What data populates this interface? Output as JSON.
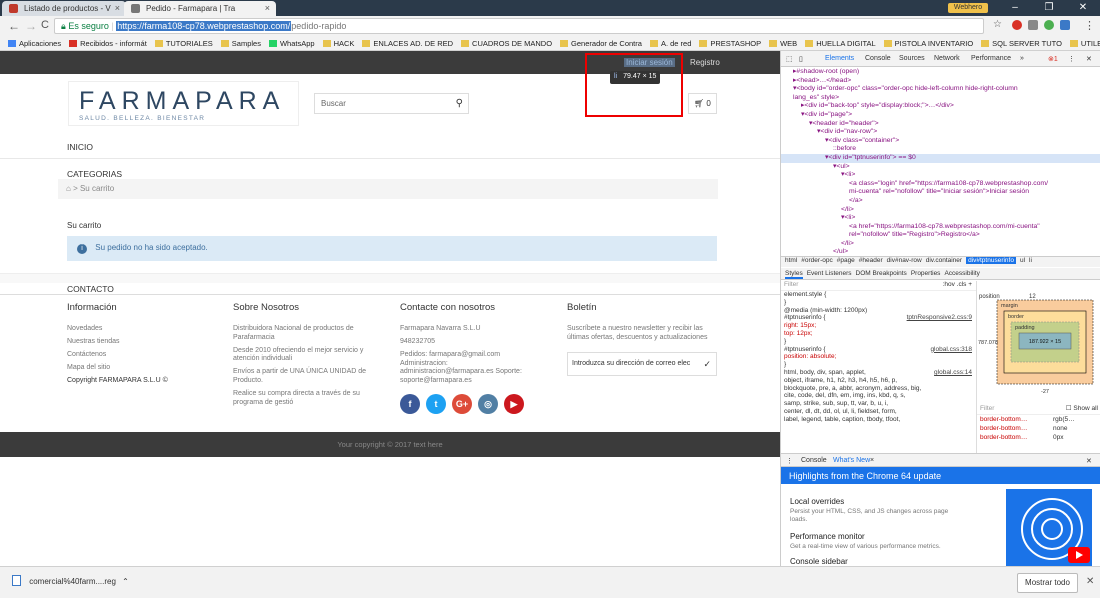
{
  "browser": {
    "tabs": [
      {
        "title": "Listado de productos - V",
        "favicon_color": "#c0392b"
      },
      {
        "title": "Pedido - Farmapara | Tra",
        "favicon_color": "#777777"
      }
    ],
    "user_chip": "Webhero",
    "address": {
      "secure_label": "Es seguro",
      "url_host": "https://farma108-cp78.webprestashop.com/",
      "url_path": "pedido-rapido"
    },
    "bookmarks": [
      "Aplicaciones",
      "Recibidos - informát",
      "TUTORIALES",
      "Samples",
      "WhatsApp",
      "HACK",
      "ENLACES AD. DE RED",
      "CUADROS DE MANDO",
      "Generador de Contra",
      "A. de red",
      "PRESTASHOP",
      "WEB",
      "HUELLA DIGITAL",
      "PISTOLA INVENTARIO",
      "SQL SERVER TUTO",
      "UTILES ADMIN. RED"
    ]
  },
  "site": {
    "topnav": {
      "login": "Iniciar sesión",
      "register": "Registro"
    },
    "inspect_tooltip": {
      "tag": "li",
      "size": "79.47 × 15"
    },
    "logo": {
      "name": "FARMAPARA",
      "tagline": "SALUD. BELLEZA. BIENESTAR"
    },
    "search_placeholder": "Buscar",
    "cart_count": "0",
    "menu": {
      "home": "INICIO",
      "categories": "CATEGORIAS",
      "contact": "CONTACTO"
    },
    "breadcrumb": [
      "Su carrito"
    ],
    "cart_title": "Su carrito",
    "alert": "Su pedido no ha sido aceptado.",
    "footer": {
      "col1": {
        "title": "Información",
        "items": [
          "Novedades",
          "Nuestras tiendas",
          "Contáctenos",
          "Mapa del sitio"
        ],
        "copy": "Copyright FARMAPARA S.L.U ©"
      },
      "col2": {
        "title": "Sobre Nosotros",
        "items": [
          "Distribuidora Nacional de productos de Parafarmacia",
          "Desde 2010 ofreciendo el mejor servicio y atención individuali",
          "Envíos a partir de UNA ÚNICA UNIDAD de Producto.",
          "Realice su compra directa a través de su programa de gestió"
        ]
      },
      "col3": {
        "title": "Contacte con nosotros",
        "items": [
          "Farmapara Navarra S.L.U",
          "948232705",
          "Pedidos: farmapara@gmail.com Administracion: administracion@farmapara.es Soporte: soporte@farmapara.es"
        ]
      },
      "col4": {
        "title": "Boletín",
        "desc": "Suscríbete a nuestro newsletter y recibir las últimas ofertas, descuentos y actualizaciones",
        "input_placeholder": "Introduzca su dirección de correo elec"
      },
      "social": [
        {
          "name": "facebook",
          "glyph": "f",
          "color": "#3b5998"
        },
        {
          "name": "twitter",
          "glyph": "t",
          "color": "#1da1f2"
        },
        {
          "name": "google-plus",
          "glyph": "G+",
          "color": "#dd4b39"
        },
        {
          "name": "instagram",
          "glyph": "◎",
          "color": "#517fa4"
        },
        {
          "name": "youtube",
          "glyph": "▶",
          "color": "#cc181e"
        }
      ],
      "copyright": "Your copyright © 2017 text here"
    }
  },
  "devtools": {
    "tabs": [
      "Elements",
      "Console",
      "Sources",
      "Network",
      "Performance"
    ],
    "more": "»",
    "errors": "1",
    "dom_lines": [
      {
        "indent": 1,
        "html": "▸#shadow-root (open)"
      },
      {
        "indent": 1,
        "html": "▸<head>…</head>"
      },
      {
        "indent": 1,
        "html": "▾<body id=\"order-opc\" class=\"order-opc hide-left-column hide-right-column"
      },
      {
        "indent": 1,
        "html": "lang_es\" style>"
      },
      {
        "indent": 2,
        "html": "▸<div id=\"back-top\" style=\"display:block;\">…</div>"
      },
      {
        "indent": 2,
        "html": "▾<div id=\"page\">"
      },
      {
        "indent": 3,
        "html": "▾<header id=\"header\">"
      },
      {
        "indent": 4,
        "html": "▾<div id=\"nav-row\">"
      },
      {
        "indent": 5,
        "html": "▾<div class=\"container\">"
      },
      {
        "indent": 6,
        "html": "::before"
      },
      {
        "indent": 5,
        "html": "▾<div id=\"tptnuserinfo\"> == $0",
        "selected": true
      },
      {
        "indent": 6,
        "html": "▾<ul>"
      },
      {
        "indent": 7,
        "html": "▾<li>"
      },
      {
        "indent": 8,
        "html": "<a class=\"login\" href=\"https://farma108-cp78.webprestashop.com/"
      },
      {
        "indent": 8,
        "html": "mi-cuenta\" rel=\"nofollow\" title=\"Iniciar sesión\">Iniciar sesión"
      },
      {
        "indent": 8,
        "html": "</a>"
      },
      {
        "indent": 7,
        "html": "</li>"
      },
      {
        "indent": 7,
        "html": "▾<li>"
      },
      {
        "indent": 8,
        "html": "<a href=\"https://farma108-cp78.webprestashop.com/mi-cuenta\""
      },
      {
        "indent": 8,
        "html": "rel=\"nofollow\" title=\"Registro\">Registro</a>"
      },
      {
        "indent": 7,
        "html": "</li>"
      },
      {
        "indent": 6,
        "html": "</ul>"
      }
    ],
    "breadcrumbs": [
      "html",
      "#order-opc",
      "#page",
      "#header",
      "div#nav-row",
      "div.container",
      "div#tptnuserinfo",
      "ul",
      "li"
    ],
    "style_tabs": [
      "Styles",
      "Event Listeners",
      "DOM Breakpoints",
      "Properties",
      "Accessibility"
    ],
    "filter_label": "Filter",
    "filter_controls": ":hov  .cls  +",
    "style_rules": [
      {
        "sel": "element.style {",
        "src": ""
      },
      {
        "sel": "}",
        "src": ""
      },
      {
        "sel": "@media (min-width: 1200px)",
        "src": ""
      },
      {
        "sel": "#tptnuserinfo {",
        "src": "tptnResponsive2.css:9"
      },
      {
        "sel": "  right: 15px;",
        "src": "",
        "prop": true
      },
      {
        "sel": "  top: 12px;",
        "src": "",
        "prop": true
      },
      {
        "sel": "}",
        "src": ""
      },
      {
        "sel": "#tptnuserinfo {",
        "src": "global.css:318"
      },
      {
        "sel": "  position: absolute;",
        "src": "",
        "prop": true
      },
      {
        "sel": "}",
        "src": ""
      },
      {
        "sel": "html, body, div, span, applet,",
        "src": "global.css:14"
      },
      {
        "sel": "object, iframe, h1, h2, h3, h4, h5, h6, p,",
        "src": ""
      },
      {
        "sel": "blockquote, pre, a, abbr, acronym, address, big,",
        "src": ""
      },
      {
        "sel": "cite, code, del, dfn, em, img, ins, kbd, q, s,",
        "src": ""
      },
      {
        "sel": "samp, strike, sub, sup, tt, var, b, u, i,",
        "src": ""
      },
      {
        "sel": "center, dl, dt, dd, ol, ul, li, fieldset, form,",
        "src": ""
      },
      {
        "sel": "label, legend, table, caption, tbody, tfoot,",
        "src": ""
      }
    ],
    "box_model": {
      "position": "12",
      "left": "787.078",
      "bottom": "-27",
      "content": "187.922 × 15",
      "margin": "margin",
      "border": "border",
      "padding": "padding"
    },
    "computed": {
      "filter": "Filter",
      "show_all": "Show all",
      "rows": [
        {
          "prop": "border-bottom…",
          "val": "rgb(5…"
        },
        {
          "prop": "border-bottom…",
          "val": "none"
        },
        {
          "prop": "border-bottom…",
          "val": "0px"
        }
      ]
    },
    "drawer": {
      "tabs": [
        "Console",
        "What's New"
      ],
      "banner": "Highlights from the Chrome 64 update",
      "items": [
        {
          "title": "Local overrides",
          "desc": "Persist your HTML, CSS, and JS changes across page loads."
        },
        {
          "title": "Performance monitor",
          "desc": "Get a real-time view of various performance metrics."
        },
        {
          "title": "Console sidebar",
          "desc": ""
        }
      ]
    }
  },
  "download": {
    "file": "comercial%40farm....reg",
    "show_all": "Mostrar todo"
  }
}
